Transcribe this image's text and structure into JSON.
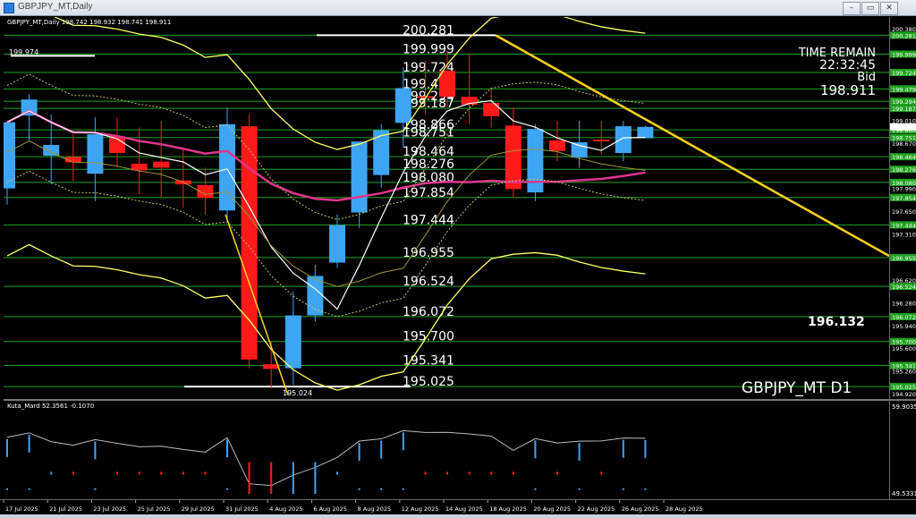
{
  "window": {
    "title": "GBPJPY_MT,Daily",
    "minimize": "–",
    "restore": "▭",
    "close": "✕"
  },
  "chart_header": "GBPJPY_MT,Daily  198.742 198.932 198.741 198.911",
  "symbol_label": "GBPJPY_MT D1",
  "time_remain": {
    "label": "TIME REMAIN",
    "value": "22:32:45",
    "bid_label": "Bid",
    "bid_value": "198.911"
  },
  "highlight_level": "196.132",
  "top_left_level": "199.974",
  "bottom_level_label": "195.024",
  "indicator_header": "Kuta_Mard 52.3561  -0.1070",
  "indicator_scale": {
    "top": "59.9035",
    "bottom": "49.5331"
  },
  "levels": [
    {
      "value": "200.281",
      "color": "#ffffff"
    },
    {
      "value": "199.999",
      "color": "#ffffff"
    },
    {
      "value": "199.724",
      "color": "#ffffff"
    },
    {
      "value": "199.479",
      "color": "#ffffff"
    },
    {
      "value": "199.294",
      "color": "#ffffff"
    },
    {
      "value": "199.187",
      "color": "#ffffff"
    },
    {
      "value": "198.866",
      "color": "#ffffff"
    },
    {
      "value": "198.751",
      "color": "#ffffff"
    },
    {
      "value": "198.464",
      "color": "#ffffff"
    },
    {
      "value": "198.276",
      "color": "#ffffff"
    },
    {
      "value": "198.080",
      "color": "#ffffff"
    },
    {
      "value": "197.854",
      "color": "#ffffff"
    },
    {
      "value": "197.444",
      "color": "#ffffff"
    },
    {
      "value": "196.955",
      "color": "#ffffff"
    },
    {
      "value": "196.524",
      "color": "#ffffff"
    },
    {
      "value": "196.072",
      "color": "#ffffff"
    },
    {
      "value": "195.700",
      "color": "#ffffff"
    },
    {
      "value": "195.341",
      "color": "#ffffff"
    },
    {
      "value": "195.025",
      "color": "#ffffff"
    }
  ],
  "price_scale_ticks": [
    "200.380",
    "200.281",
    "199.999",
    "199.724",
    "199.479",
    "199.294",
    "199.187",
    "199.010",
    "198.866",
    "198.751",
    "198.670",
    "198.464",
    "198.276",
    "198.080",
    "197.990",
    "197.854",
    "197.650",
    "197.444",
    "197.310",
    "196.955",
    "196.620",
    "196.524",
    "196.280",
    "196.072",
    "195.940",
    "195.700",
    "195.600",
    "195.341",
    "195.260",
    "195.025",
    "194.920"
  ],
  "time_labels": [
    "17 Jul 2025",
    "21 Jul 2025",
    "23 Jul 2025",
    "25 Jul 2025",
    "29 Jul 2025",
    "31 Jul 2025",
    "4 Aug 2025",
    "6 Aug 2025",
    "8 Aug 2025",
    "12 Aug 2025",
    "14 Aug 2025",
    "18 Aug 2025",
    "20 Aug 2025",
    "22 Aug 2025",
    "26 Aug 2025",
    "28 Aug 2025"
  ],
  "colors": {
    "bull": "#3da5f4",
    "bear": "#ff1a1a",
    "grid": "#1fa31f",
    "trend": "#ffd21f",
    "ma_pink": "#e0358f",
    "ma_white": "#ffffff",
    "band_yellow": "#ffff66"
  },
  "chart_data": {
    "type": "candlestick",
    "title": "GBPJPY_MT,Daily",
    "ylim": [
      194.92,
      200.38
    ],
    "candles": [
      {
        "o": 197.99,
        "h": 198.9,
        "c": 198.98,
        "l": 197.75
      },
      {
        "o": 199.08,
        "h": 199.4,
        "c": 199.32,
        "l": 198.7
      },
      {
        "o": 198.48,
        "h": 199.1,
        "c": 198.64,
        "l": 198.05
      },
      {
        "o": 198.46,
        "h": 198.8,
        "c": 198.38,
        "l": 198.1
      },
      {
        "o": 198.21,
        "h": 199.05,
        "c": 198.8,
        "l": 197.8
      },
      {
        "o": 198.77,
        "h": 199.05,
        "c": 198.52,
        "l": 198.3
      },
      {
        "o": 198.36,
        "h": 198.9,
        "c": 198.26,
        "l": 197.9
      },
      {
        "o": 198.39,
        "h": 199.0,
        "c": 198.3,
        "l": 197.85
      },
      {
        "o": 198.11,
        "h": 198.6,
        "c": 198.05,
        "l": 197.7
      },
      {
        "o": 198.04,
        "h": 198.3,
        "c": 197.85,
        "l": 197.6
      },
      {
        "o": 197.66,
        "h": 199.2,
        "c": 198.95,
        "l": 197.5
      },
      {
        "o": 198.92,
        "h": 199.1,
        "c": 195.43,
        "l": 195.3
      },
      {
        "o": 195.36,
        "h": 195.7,
        "c": 195.29,
        "l": 195.0
      },
      {
        "o": 195.3,
        "h": 196.45,
        "c": 196.09,
        "l": 195.05
      },
      {
        "o": 196.09,
        "h": 196.85,
        "c": 196.68,
        "l": 196.0
      },
      {
        "o": 196.88,
        "h": 197.6,
        "c": 197.44,
        "l": 196.8
      },
      {
        "o": 197.63,
        "h": 198.6,
        "c": 198.69,
        "l": 197.4
      },
      {
        "o": 198.19,
        "h": 198.95,
        "c": 198.86,
        "l": 198.0
      },
      {
        "o": 198.97,
        "h": 199.8,
        "c": 199.49,
        "l": 198.6
      },
      {
        "o": 199.37,
        "h": 199.9,
        "c": 199.35,
        "l": 199.1
      },
      {
        "o": 199.75,
        "h": 200.05,
        "c": 199.36,
        "l": 199.2
      },
      {
        "o": 199.36,
        "h": 200.0,
        "c": 199.24,
        "l": 198.95
      },
      {
        "o": 199.27,
        "h": 199.5,
        "c": 199.07,
        "l": 198.9
      },
      {
        "o": 198.93,
        "h": 199.2,
        "c": 197.98,
        "l": 197.85
      },
      {
        "o": 197.93,
        "h": 198.95,
        "c": 198.88,
        "l": 197.8
      },
      {
        "o": 198.71,
        "h": 199.0,
        "c": 198.55,
        "l": 198.4
      },
      {
        "o": 198.45,
        "h": 199.0,
        "c": 198.68,
        "l": 198.3
      },
      {
        "o": 198.72,
        "h": 199.0,
        "c": 198.7,
        "l": 198.5
      },
      {
        "o": 198.52,
        "h": 199.0,
        "c": 198.92,
        "l": 198.4
      },
      {
        "o": 198.74,
        "h": 198.93,
        "c": 198.91,
        "l": 198.74
      }
    ]
  }
}
